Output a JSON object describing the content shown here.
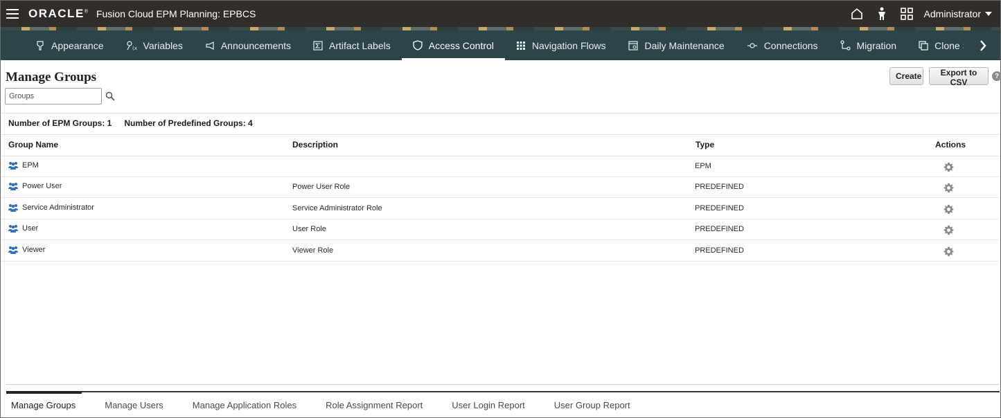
{
  "header": {
    "brand": "ORACLE",
    "app_title": "Fusion Cloud EPM Planning:  EPBCS",
    "user": "Administrator",
    "icons": [
      "menu-icon",
      "home-icon",
      "accessibility-icon",
      "navigator-grid-icon",
      "caret-down-icon"
    ]
  },
  "nav": {
    "items": [
      {
        "label": "Appearance",
        "icon": "appearance-icon"
      },
      {
        "label": "Variables",
        "icon": "variables-icon"
      },
      {
        "label": "Announcements",
        "icon": "megaphone-icon"
      },
      {
        "label": "Artifact Labels",
        "icon": "sigma-icon"
      },
      {
        "label": "Access Control",
        "icon": "shield-icon",
        "active": true
      },
      {
        "label": "Navigation Flows",
        "icon": "grid-icon"
      },
      {
        "label": "Daily Maintenance",
        "icon": "calendar-gear-icon"
      },
      {
        "label": "Connections",
        "icon": "connections-icon"
      },
      {
        "label": "Migration",
        "icon": "migration-icon"
      },
      {
        "label": "Clone Sna",
        "icon": "clone-icon"
      }
    ],
    "next_icon": "chevron-right-icon"
  },
  "page": {
    "title": "Manage Groups",
    "search_placeholder": "Groups",
    "create_label": "Create",
    "export_label": "Export to CSV",
    "help": "?",
    "epm_groups_count": "Number of EPM Groups: 1",
    "predefined_groups_count": "Number of Predefined Groups: 4"
  },
  "table": {
    "columns": {
      "name": "Group Name",
      "description": "Description",
      "type": "Type",
      "actions": "Actions"
    },
    "rows": [
      {
        "name": "EPM",
        "description": "",
        "type": "EPM"
      },
      {
        "name": "Power User",
        "description": "Power User Role",
        "type": "PREDEFINED"
      },
      {
        "name": "Service Administrator",
        "description": "Service Administrator Role",
        "type": "PREDEFINED"
      },
      {
        "name": "User",
        "description": "User Role",
        "type": "PREDEFINED"
      },
      {
        "name": "Viewer",
        "description": "Viewer Role",
        "type": "PREDEFINED"
      }
    ]
  },
  "bottom_tabs": [
    {
      "label": "Manage Groups",
      "active": true
    },
    {
      "label": "Manage Users"
    },
    {
      "label": "Manage Application Roles"
    },
    {
      "label": "Role Assignment Report"
    },
    {
      "label": "User Login Report"
    },
    {
      "label": "User Group Report"
    }
  ],
  "colors": {
    "header_bg": "#312d2a",
    "navbar_bg": "#2c4548",
    "accent": "#2f3b3c",
    "group_icon": "#2a6fc0"
  }
}
